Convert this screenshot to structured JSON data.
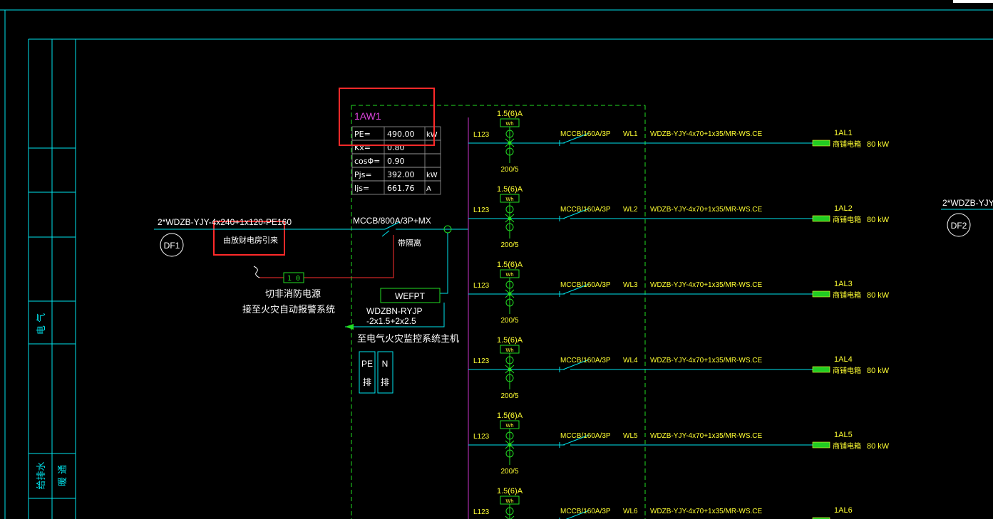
{
  "colors": {
    "background": "#000000",
    "frame_cyan": "#00e5ee",
    "dashed_green": "#22dd22",
    "bus_magenta": "#cc33cc",
    "label_yellow": "#ffff33",
    "title_magenta": "#dd44dd",
    "highlight_red": "#ff2a2a",
    "control_red": "#ff3030",
    "text_white": "#ffffff",
    "load_green": "#22cc22"
  },
  "title_block": {
    "electrical_label": "电 气",
    "water_label": "给排水",
    "hvac_label": "暖 通"
  },
  "panel": {
    "name": "1AW1",
    "params": [
      {
        "key": "PE=",
        "value": "490.00",
        "unit": "kW"
      },
      {
        "key": "Kx=",
        "value": "0.80",
        "unit": ""
      },
      {
        "key": "cosΦ=",
        "value": "0.90",
        "unit": ""
      },
      {
        "key": "Pjs=",
        "value": "392.00",
        "unit": "kW"
      },
      {
        "key": "Ijs=",
        "value": "661.76",
        "unit": "A"
      }
    ]
  },
  "incoming": {
    "cable": "2*WDZB-YJY-4x240+1x120-PE160",
    "source": "DF1",
    "note": "由放财电房引来",
    "main_breaker": "MCCB/800A/3P+MX",
    "breaker_note": "带隔离",
    "fire_cut_note_1": "切非消防电源",
    "fire_cut_note_2": "接至火灾自动报警系统",
    "relay_label": "1  0"
  },
  "monitor": {
    "device": "WEFPT",
    "cable_1": "WDZBN-RYJP",
    "cable_2": "-2x1.5+2x2.5",
    "target": "至电气火灾监控系统主机",
    "pe_bar": "PE",
    "pe_bar_sub": "排",
    "n_bar": "N",
    "n_bar_sub": "排"
  },
  "right_edge": {
    "cable": "2*WDZB-YJY",
    "source": "DF2"
  },
  "feeders": [
    {
      "meter": "1.5(6)A",
      "meter_tag": "Wh",
      "phase": "L123",
      "ct": "200/5",
      "breaker": "MCCB/160A/3P",
      "circuit": "WL1",
      "cable": "WDZB-YJY-4x70+1x35/MR-WS.CE",
      "load_id": "1AL1",
      "load_type": "商铺电箱",
      "power": "80 kW"
    },
    {
      "meter": "1.5(6)A",
      "meter_tag": "Wh",
      "phase": "L123",
      "ct": "200/5",
      "breaker": "MCCB/160A/3P",
      "circuit": "WL2",
      "cable": "WDZB-YJY-4x70+1x35/MR-WS.CE",
      "load_id": "1AL2",
      "load_type": "商铺电箱",
      "power": "80 kW"
    },
    {
      "meter": "1.5(6)A",
      "meter_tag": "Wh",
      "phase": "L123",
      "ct": "200/5",
      "breaker": "MCCB/160A/3P",
      "circuit": "WL3",
      "cable": "WDZB-YJY-4x70+1x35/MR-WS.CE",
      "load_id": "1AL3",
      "load_type": "商铺电箱",
      "power": "80 kW"
    },
    {
      "meter": "1.5(6)A",
      "meter_tag": "Wh",
      "phase": "L123",
      "ct": "200/5",
      "breaker": "MCCB/160A/3P",
      "circuit": "WL4",
      "cable": "WDZB-YJY-4x70+1x35/MR-WS.CE",
      "load_id": "1AL4",
      "load_type": "商铺电箱",
      "power": "80 kW"
    },
    {
      "meter": "1.5(6)A",
      "meter_tag": "Wh",
      "phase": "L123",
      "ct": "200/5",
      "breaker": "MCCB/160A/3P",
      "circuit": "WL5",
      "cable": "WDZB-YJY-4x70+1x35/MR-WS.CE",
      "load_id": "1AL5",
      "load_type": "商铺电箱",
      "power": "80 kW"
    },
    {
      "meter": "1.5(6)A",
      "meter_tag": "Wh",
      "phase": "L123",
      "ct": "",
      "breaker": "MCCB/160A/3P",
      "circuit": "WL6",
      "cable": "WDZB-YJY-4x70+1x35/MR-WS.CE",
      "load_id": "1AL6",
      "load_type": "",
      "power": ""
    }
  ]
}
